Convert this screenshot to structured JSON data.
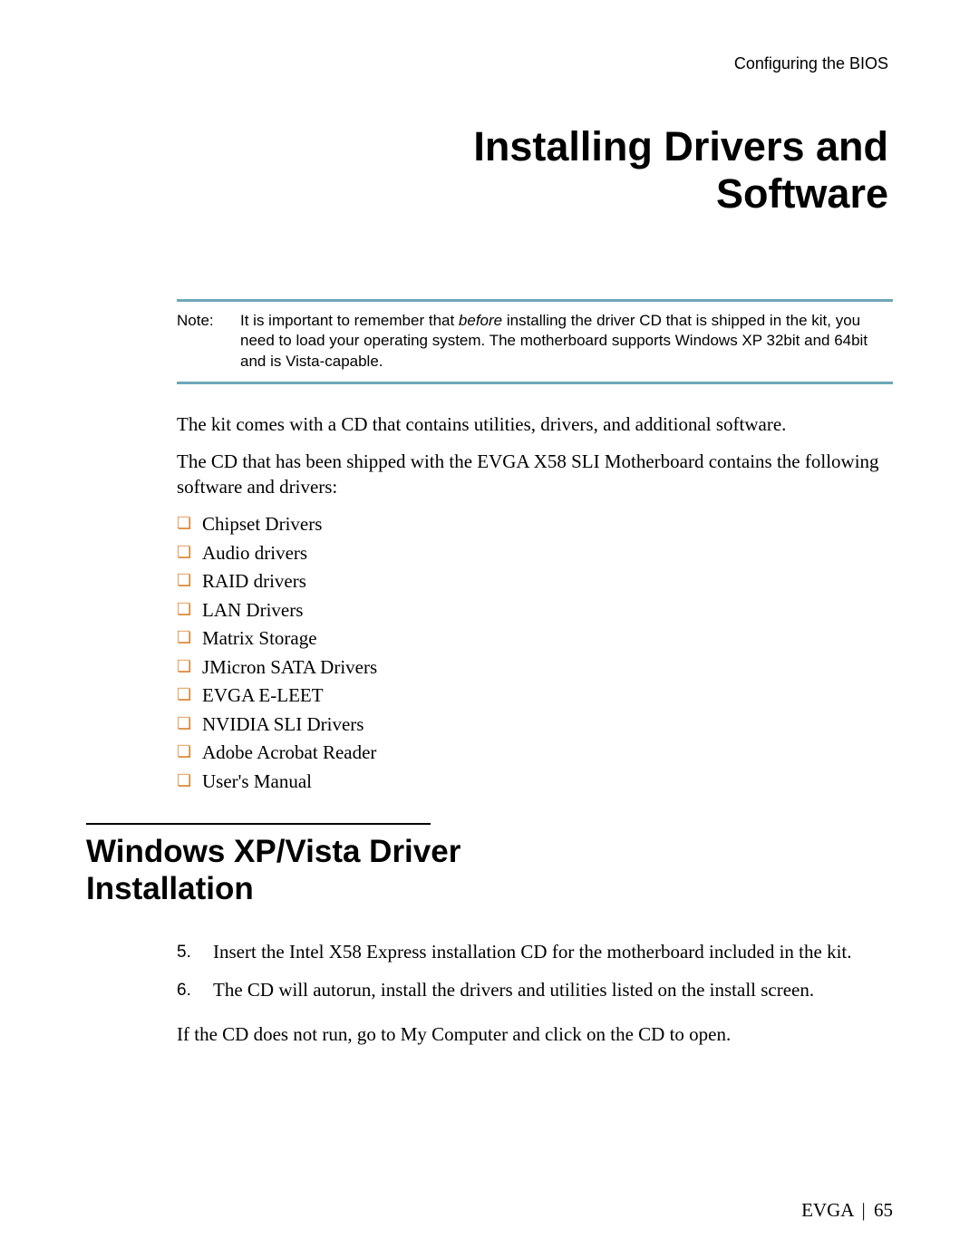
{
  "header": {
    "section_label": "Configuring the BIOS"
  },
  "chapter": {
    "title_line1": "Installing Drivers and",
    "title_line2": "Software"
  },
  "note": {
    "label": "Note:",
    "text_before_italic": "It is important to remember that ",
    "italic_word": "before",
    "text_after_italic": " installing the driver CD that is shipped in the kit, you need to load your operating system. The motherboard supports Windows XP 32bit and 64bit and is Vista-capable."
  },
  "intro": {
    "p1": "The kit comes with a CD that contains utilities, drivers, and additional software.",
    "p2": "The CD that has been shipped with the EVGA X58 SLI Motherboard contains the following software and drivers:"
  },
  "bullets": [
    "Chipset Drivers",
    "Audio drivers",
    "RAID drivers",
    "LAN Drivers",
    "Matrix Storage",
    "JMicron SATA Drivers",
    "EVGA E-LEET",
    "NVIDIA SLI Drivers",
    "Adobe Acrobat Reader",
    "User's Manual"
  ],
  "section": {
    "title_line1": "Windows XP/Vista Driver",
    "title_line2": "Installation"
  },
  "steps": [
    {
      "num": "5.",
      "text": "Insert the Intel X58 Express installation CD for the motherboard included in the kit."
    },
    {
      "num": "6.",
      "text": "The CD will autorun, install the drivers and utilities listed on the install screen."
    }
  ],
  "closing": "If the CD does not run, go to My Computer and click on the CD to open.",
  "footer": {
    "brand": "EVGA",
    "sep": "|",
    "page": "65"
  }
}
